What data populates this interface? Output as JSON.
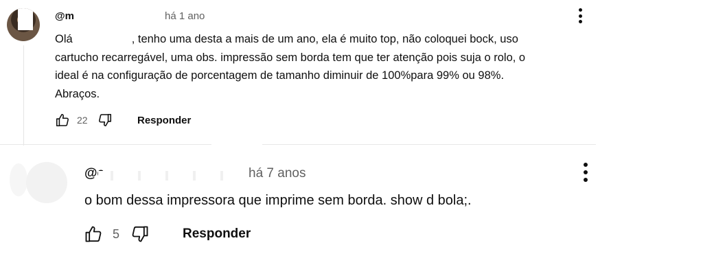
{
  "comments": [
    {
      "handle": "@m",
      "time": "há 1 ano",
      "text_lines": [
        "Olá",
        ", tenho uma desta a mais de um ano, ela é muito top, não coloquei bock, uso",
        "cartucho recarregável, uma obs. impressão sem borda tem que ter atenção pois suja o rolo, o",
        "ideal é na configuração de porcentagem de tamanho diminuir de 100%para 99% ou 98%.",
        "Abraços."
      ],
      "likes": "22",
      "reply_label": "Responder",
      "icons": {
        "like": "thumbs-up-icon",
        "dislike": "thumbs-down-icon",
        "menu": "more-vert-icon"
      }
    },
    {
      "handle": "@e",
      "time": "há 7 anos",
      "text": "o bom dessa impressora que imprime sem borda. show d bola;.",
      "likes": "5",
      "reply_label": "Responder",
      "icons": {
        "like": "thumbs-up-icon",
        "dislike": "thumbs-down-icon",
        "menu": "more-vert-icon"
      }
    }
  ],
  "colors": {
    "text": "#0f0f0f",
    "secondary": "#606060",
    "divider": "#e8e8e8"
  }
}
